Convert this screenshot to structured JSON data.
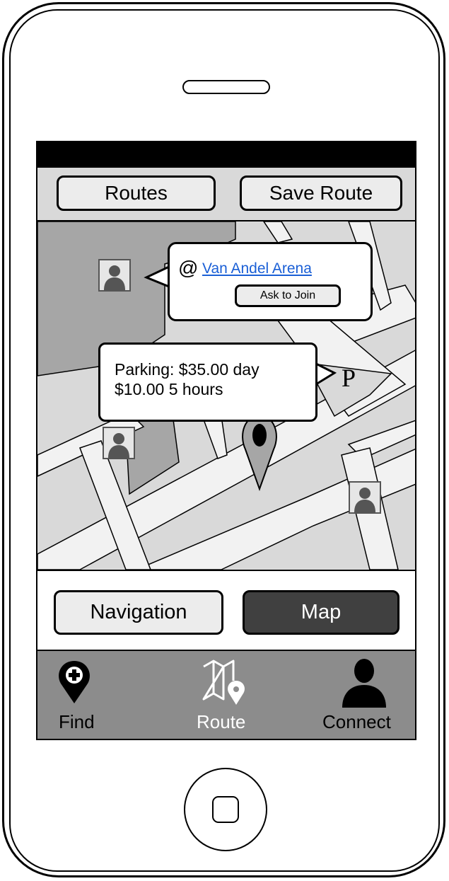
{
  "top_bar": {
    "routes_label": "Routes",
    "save_route_label": "Save Route"
  },
  "map": {
    "arena_callout": {
      "at_symbol": "@",
      "venue_link": "Van Andel Arena",
      "ask_button": "Ask to Join"
    },
    "parking_callout": {
      "line1": "Parking: $35.00 day",
      "line2": "$10.00 5 hours"
    },
    "parking_marker": "P"
  },
  "mode_bar": {
    "navigation_label": "Navigation",
    "map_label": "Map",
    "selected": "Map"
  },
  "tab_bar": {
    "find_label": "Find",
    "route_label": "Route",
    "connect_label": "Connect",
    "active": "Route"
  },
  "icons": {
    "find": "map-pin-plus-icon",
    "route": "folded-map-pin-icon",
    "connect": "person-icon",
    "avatar": "person-avatar-icon",
    "location": "location-pin-icon"
  },
  "colors": {
    "map_building": "#a6a6a6",
    "map_block": "#d9d9d9",
    "map_road": "#f2f2f2",
    "tab_bar_bg": "#8c8c8c",
    "active_button_bg": "#404040",
    "link": "#1a5fd6"
  }
}
